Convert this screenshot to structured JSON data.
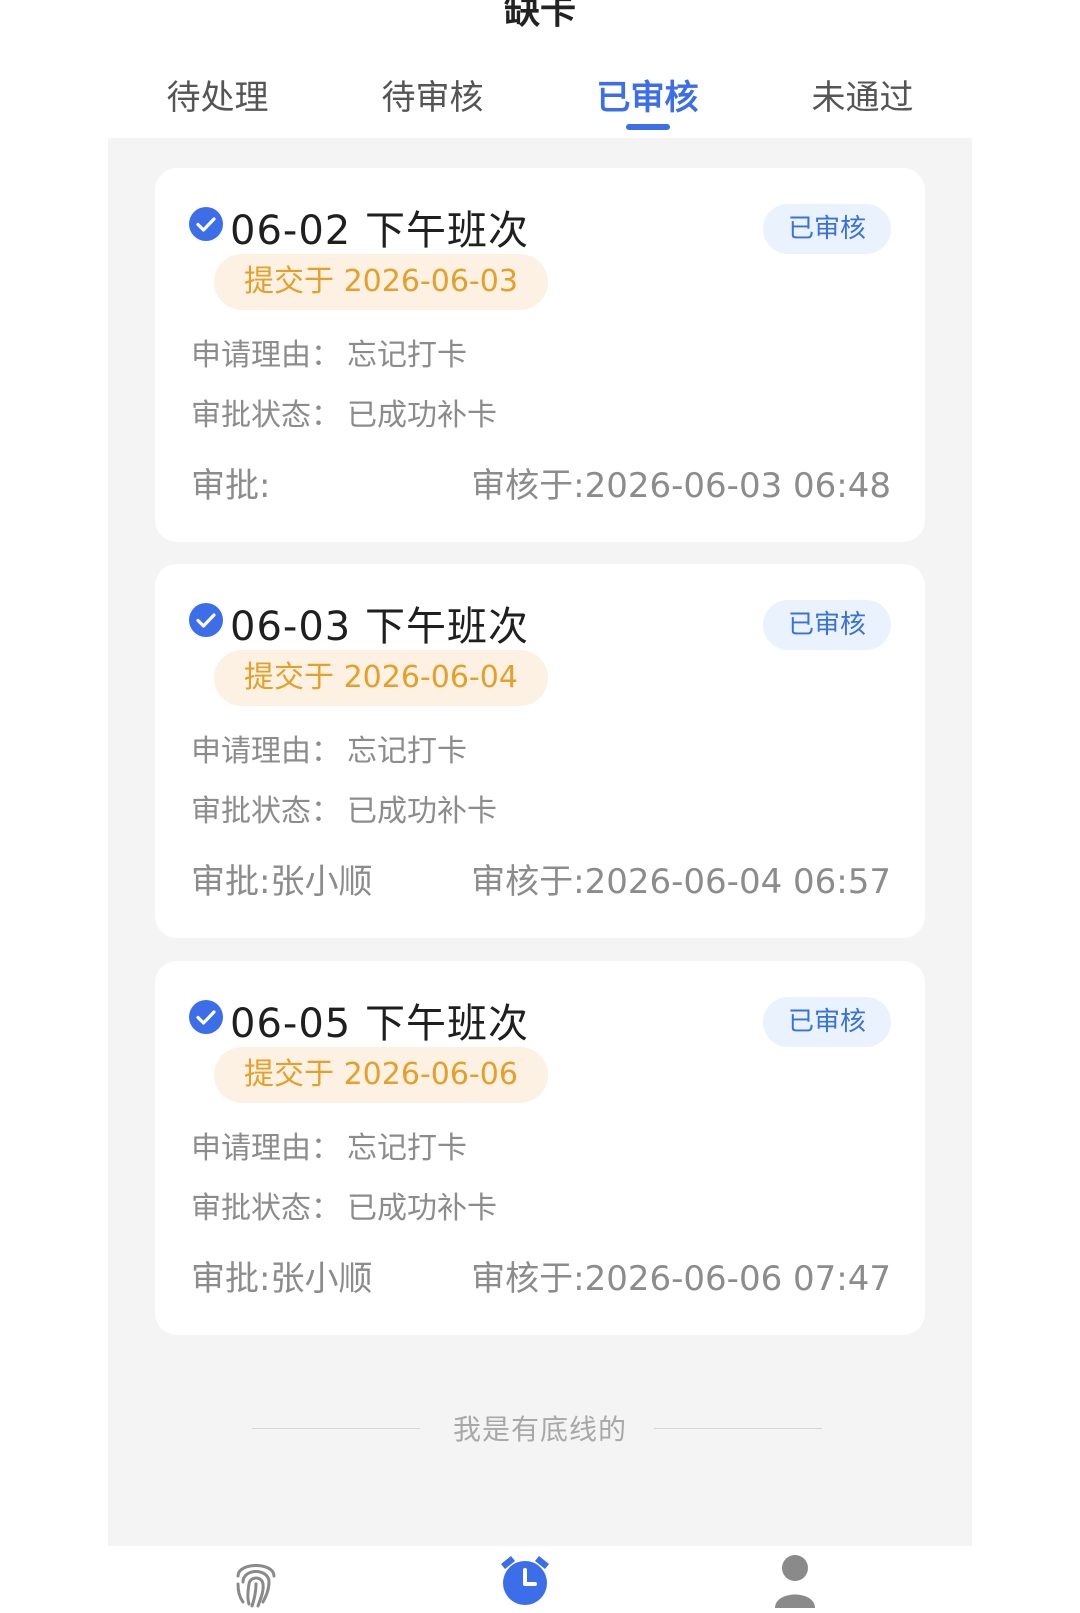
{
  "header": {
    "title": "缺卡"
  },
  "tabs": [
    {
      "label": "待处理",
      "active": false
    },
    {
      "label": "待审核",
      "active": false
    },
    {
      "label": "已审核",
      "active": true
    },
    {
      "label": "未通过",
      "active": false
    }
  ],
  "records": [
    {
      "title": "06-02 下午班次",
      "badge": "已审核",
      "submitted": "提交于 2026-06-03",
      "reason_label": "申请理由：",
      "reason_value": "忘记打卡",
      "status_label": "审批状态：",
      "status_value": "已成功补卡",
      "approver": "审批:",
      "reviewed": "审核于:2026-06-03 06:48"
    },
    {
      "title": "06-03 下午班次",
      "badge": "已审核",
      "submitted": "提交于 2026-06-04",
      "reason_label": "申请理由：",
      "reason_value": "忘记打卡",
      "status_label": "审批状态：",
      "status_value": "已成功补卡",
      "approver": "审批:张小顺",
      "reviewed": "审核于:2026-06-04 06:57"
    },
    {
      "title": "06-05 下午班次",
      "badge": "已审核",
      "submitted": "提交于 2026-06-06",
      "reason_label": "申请理由：",
      "reason_value": "忘记打卡",
      "status_label": "审批状态：",
      "status_value": "已成功补卡",
      "approver": "审批:张小顺",
      "reviewed": "审核于:2026-06-06 07:47"
    }
  ],
  "end_text": "我是有底线的",
  "nav": {
    "items": [
      {
        "icon": "fingerprint-icon"
      },
      {
        "icon": "alarm-clock-icon"
      },
      {
        "icon": "user-icon"
      }
    ]
  },
  "colors": {
    "accent": "#3b6ee8",
    "badge_bg": "#e9f2fd",
    "pill_bg": "#fdf1e4",
    "pill_text": "#e4a028",
    "content_bg": "#f4f4f5"
  }
}
